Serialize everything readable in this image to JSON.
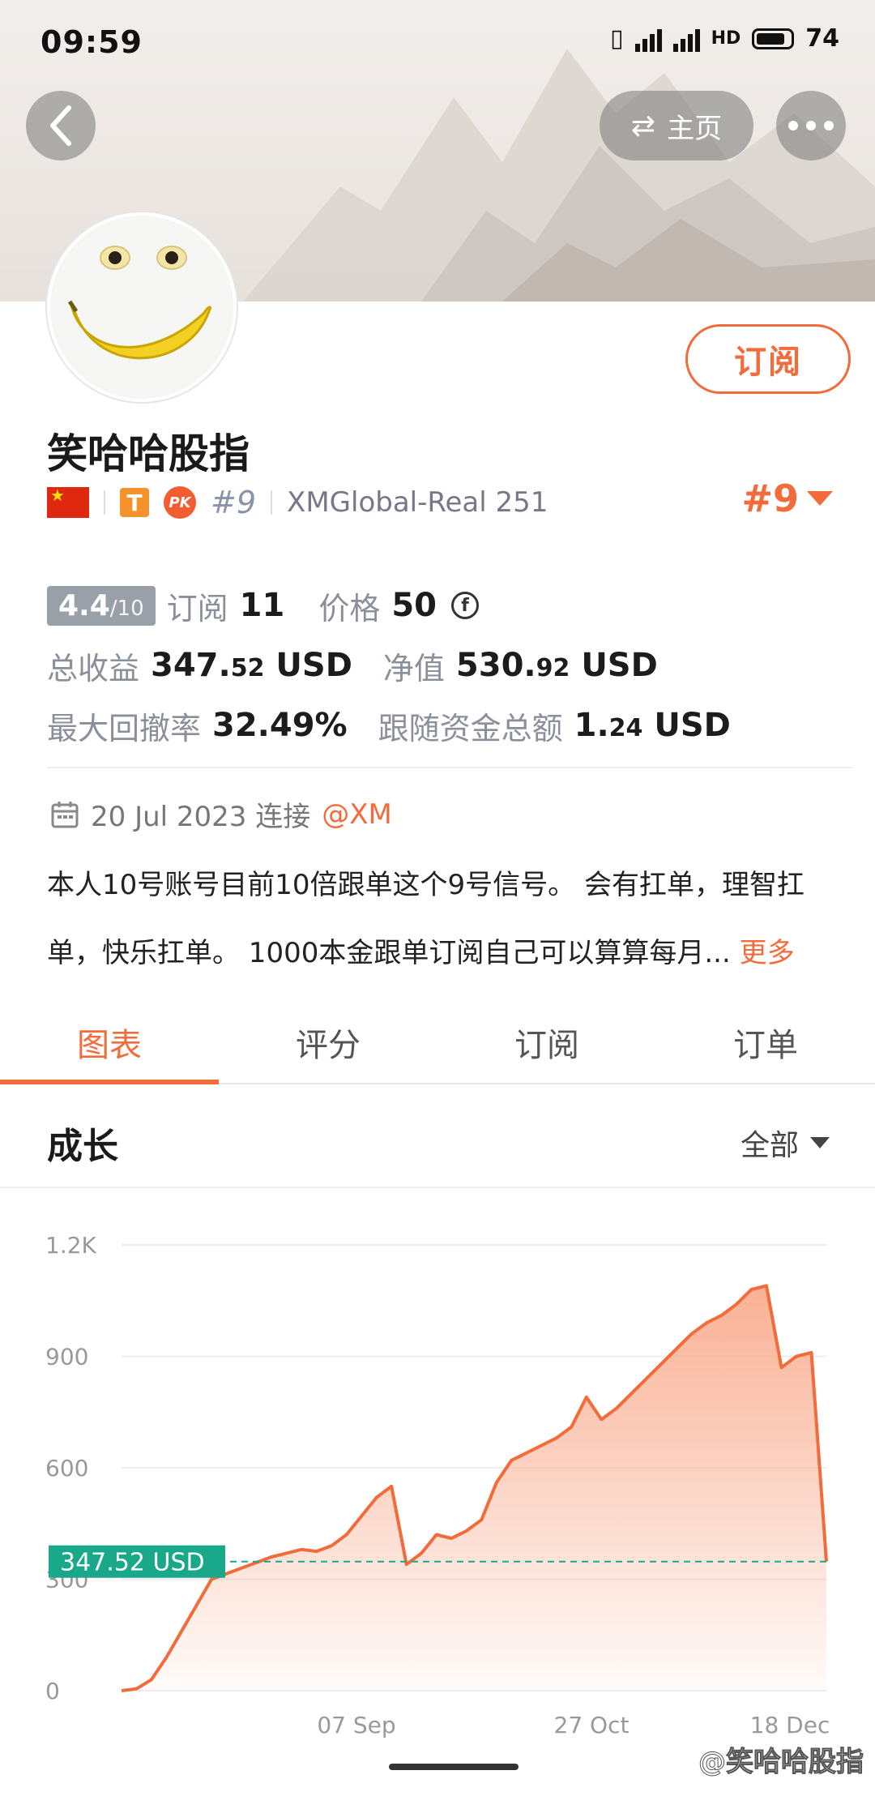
{
  "status_bar": {
    "time": "09:59",
    "battery": "74",
    "net1": "4G",
    "net2": "4G"
  },
  "nav": {
    "home_label": "主页"
  },
  "profile": {
    "subscribe_label": "订阅",
    "name": "笑哈哈股指",
    "badge_t": "T",
    "badge_pk": "PK",
    "rank": "#9",
    "account": "XMGlobal-Real 251",
    "rank_right": "#9"
  },
  "stats": {
    "score": "4.4",
    "score_max": "/10",
    "subscribe_label": "订阅",
    "subscribe_count": "11",
    "price_label": "价格",
    "price_value": "50",
    "coin_symbol": "f",
    "total_profit_label": "总收益",
    "total_profit_int": "347.",
    "total_profit_dec": "52",
    "total_profit_unit": "USD",
    "equity_label": "净值",
    "equity_int": "530.",
    "equity_dec": "92",
    "equity_unit": "USD",
    "drawdown_label": "最大回撤率",
    "drawdown_value": "32.49%",
    "follow_label": "跟随资金总额",
    "follow_int": "1.",
    "follow_dec": "24",
    "follow_unit": "USD"
  },
  "connection": {
    "date_text": "20 Jul 2023 连接",
    "broker": "@XM"
  },
  "description": {
    "line1": "本人10号账号目前10倍跟单这个9号信号。 会有扛单，理智扛",
    "line2": "单，快乐扛单。 1000本金跟单订阅自己可以算算每月...",
    "more": "更多"
  },
  "tabs": [
    "图表",
    "评分",
    "订阅",
    "订单"
  ],
  "growth": {
    "title": "成长",
    "period": "全部"
  },
  "chart_data": {
    "type": "area",
    "y_ticks": [
      "1.2K",
      "900",
      "600",
      "300",
      "0"
    ],
    "ylim": [
      0,
      1200
    ],
    "x_ticks": [
      "07 Sep",
      "27 Oct",
      "18 Dec"
    ],
    "current_value_label": "347.52 USD",
    "current_value": 347.52,
    "series": [
      {
        "values": [
          0,
          5,
          30,
          90,
          160,
          230,
          300,
          315,
          330,
          345,
          360,
          370,
          380,
          375,
          390,
          420,
          470,
          520,
          550,
          340,
          370,
          420,
          410,
          430,
          460,
          560,
          620,
          640,
          660,
          680,
          710,
          790,
          730,
          760,
          800,
          840,
          880,
          920,
          960,
          990,
          1010,
          1040,
          1080,
          1090,
          870,
          900,
          910,
          347.52
        ]
      }
    ],
    "colors": {
      "line": "#f26b3a",
      "fill": "#f9a889",
      "ref_line": "#1aa88a"
    }
  },
  "watermark": "@笑哈哈股指"
}
